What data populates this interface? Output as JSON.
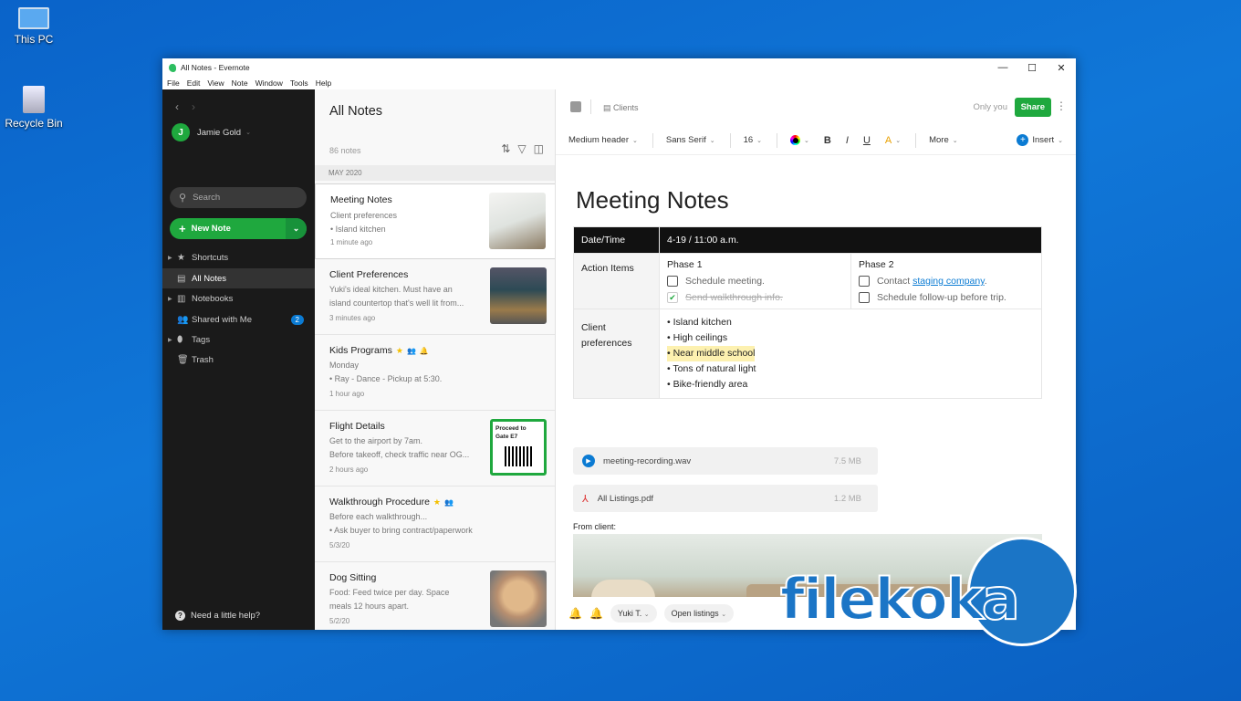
{
  "desktop": {
    "icons": [
      {
        "label": "This PC"
      },
      {
        "label": "Recycle Bin"
      }
    ]
  },
  "window": {
    "title": "All Notes - Evernote",
    "menu": [
      "File",
      "Edit",
      "View",
      "Note",
      "Window",
      "Tools",
      "Help"
    ]
  },
  "sidebar": {
    "user": "Jamie Gold",
    "avatar_initial": "J",
    "search_placeholder": "Search",
    "new_note": "New Note",
    "items": [
      {
        "label": "Shortcuts",
        "icon": "star-icon"
      },
      {
        "label": "All Notes",
        "icon": "note-icon"
      },
      {
        "label": "Notebooks",
        "icon": "notebook-icon"
      },
      {
        "label": "Shared with Me",
        "icon": "people-icon",
        "badge": "2"
      },
      {
        "label": "Tags",
        "icon": "tag-icon"
      },
      {
        "label": "Trash",
        "icon": "trash-icon"
      }
    ],
    "help": "Need a little help?"
  },
  "list": {
    "title": "All Notes",
    "count": "86 notes",
    "month": "MAY 2020",
    "notes": [
      {
        "title": "Meeting Notes",
        "line1": "Client preferences",
        "line2": "• Island kitchen",
        "date": "1 minute ago"
      },
      {
        "title": "Client Preferences",
        "line1": "Yuki's ideal kitchen. Must have an",
        "line2": "island countertop that's well lit from...",
        "date": "3 minutes ago"
      },
      {
        "title": "Kids Programs",
        "line1": "Monday",
        "line2": "• Ray - Dance - Pickup at 5:30.",
        "date": "1 hour ago"
      },
      {
        "title": "Flight Details",
        "line1": "Get to the airport by 7am.",
        "line2": "Before takeoff, check traffic near OG...",
        "date": "2 hours ago",
        "thumb_text": "Proceed to Gate E7"
      },
      {
        "title": "Walkthrough Procedure",
        "line1": "Before each walkthrough...",
        "line2": "•  Ask buyer to bring contract/paperwork",
        "date": "5/3/20"
      },
      {
        "title": "Dog Sitting",
        "line1": "Food: Feed twice per day. Space",
        "line2": "meals 12 hours apart.",
        "date": "5/2/20"
      }
    ]
  },
  "editor": {
    "notebook": "Clients",
    "sharing": "Only you",
    "share": "Share",
    "toolbar": {
      "style": "Medium header",
      "font": "Sans Serif",
      "size": "16",
      "bold": "B",
      "italic": "I",
      "underline": "U",
      "more": "More",
      "insert": "Insert"
    },
    "title": "Meeting Notes",
    "table": {
      "date_label": "Date/Time",
      "date_value": "4-19 / 11:00 a.m.",
      "action_label": "Action Items",
      "phase1": "Phase 1",
      "phase1_tasks": [
        {
          "text": "Schedule meeting.",
          "done": false
        },
        {
          "text": "Send walkthrough info.",
          "done": true
        }
      ],
      "phase2": "Phase 2",
      "phase2_task1_prefix": "Contact ",
      "phase2_task1_link": "staging company",
      "phase2_task1_suffix": ".",
      "phase2_task2": "Schedule follow-up before trip.",
      "prefs_label": "Client preferences",
      "prefs": [
        "• Island kitchen",
        "• High ceilings",
        "• Near middle school",
        "• Tons of natural light",
        "• Bike-friendly area"
      ]
    },
    "attachments": [
      {
        "name": "meeting-recording.wav",
        "size": "7.5 MB"
      },
      {
        "name": "All Listings.pdf",
        "size": "1.2 MB"
      }
    ],
    "from_client": "From client:",
    "bottom": {
      "assignee": "Yuki T.",
      "listing": "Open listings"
    }
  },
  "watermark": "filekoka",
  "colors": {
    "accent": "#1fa83e",
    "sidebar": "#1a1a1a",
    "link": "#0b7bd3"
  }
}
